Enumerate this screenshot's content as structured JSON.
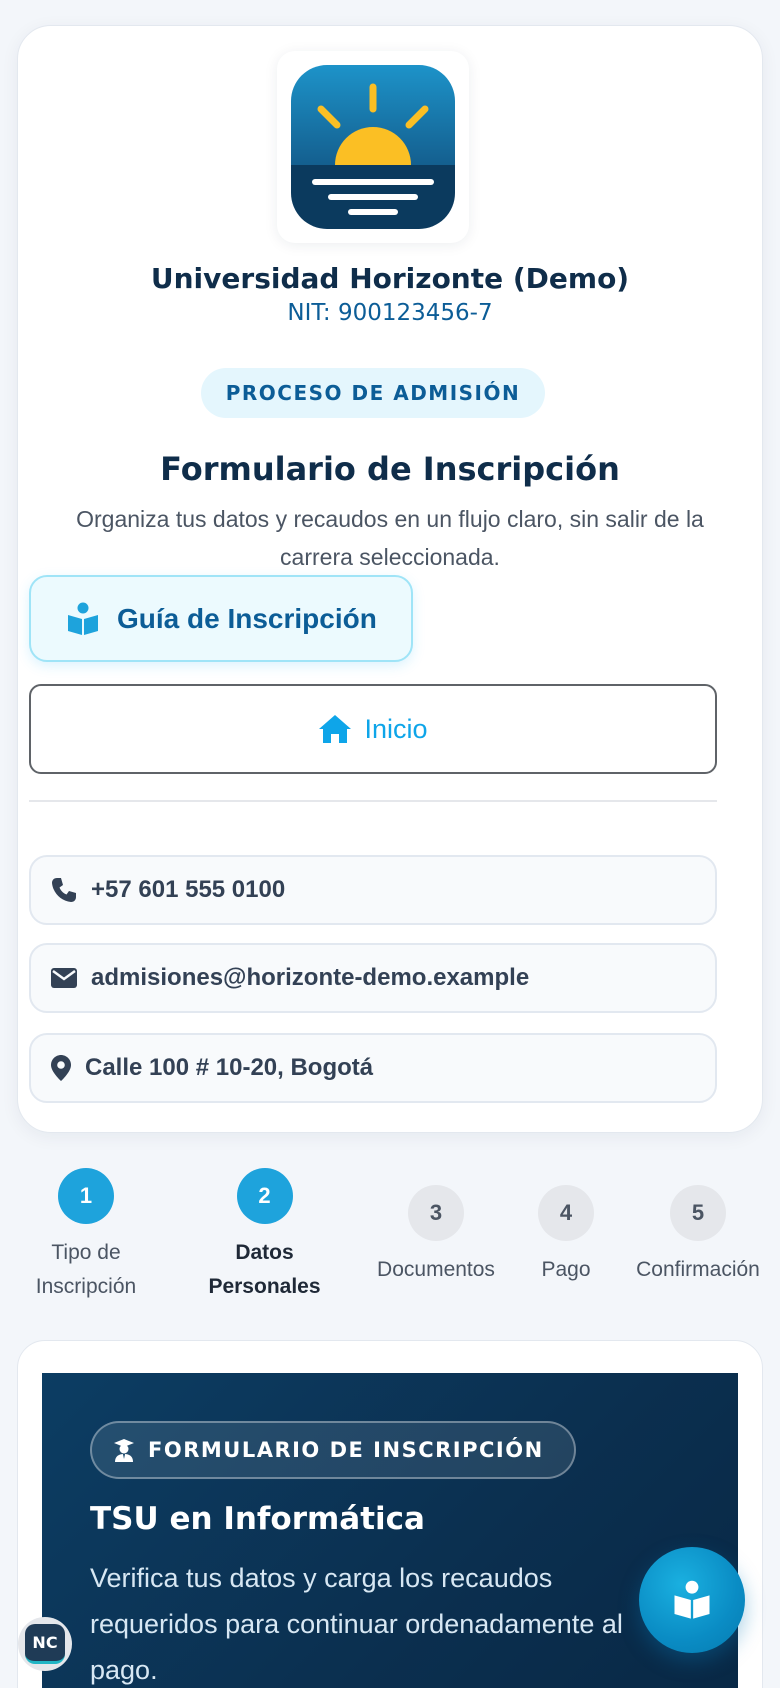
{
  "header": {
    "logo_icon": "sunrise-logo-icon",
    "university_name": "Universidad Horizonte (Demo)",
    "nit": "NIT: 900123456-7",
    "process_badge": "PROCESO DE ADMISIÓN",
    "form_title": "Formulario de Inscripción",
    "form_description": "Organiza tus datos y recaudos en un flujo claro, sin salir de la carrera seleccionada."
  },
  "actions": {
    "guide_label": "Guía de Inscripción",
    "guide_icon": "book-reader-icon",
    "home_label": "Inicio",
    "home_icon": "home-icon"
  },
  "contacts": [
    {
      "icon": "phone-icon",
      "text": "+57 601 555 0100"
    },
    {
      "icon": "envelope-icon",
      "text": "admisiones@horizonte-demo.example"
    },
    {
      "icon": "map-pin-icon",
      "text": "Calle 100 # 10-20, Bogotá"
    }
  ],
  "stepper": {
    "current_step": 2,
    "steps": [
      {
        "number": "1",
        "label": "Tipo de Inscripción",
        "state": "done"
      },
      {
        "number": "2",
        "label": "Datos Personales",
        "state": "current"
      },
      {
        "number": "3",
        "label": "Documentos",
        "state": "pending"
      },
      {
        "number": "4",
        "label": "Pago",
        "state": "pending"
      },
      {
        "number": "5",
        "label": "Confirmación",
        "state": "pending"
      }
    ]
  },
  "hero": {
    "badge_icon": "graduate-icon",
    "badge_label": "FORMULARIO DE INSCRIPCIÓN",
    "program_title": "TSU en Informática",
    "description": "Verifica tus datos y carga los recaudos requeridos para continuar ordenadamente al pago."
  },
  "fab": {
    "icon": "book-reader-icon"
  },
  "corner_badge": {
    "text": "NC"
  },
  "colors": {
    "primary": "#0c5d97",
    "accent": "#1ea3dc",
    "dark_navy": "#0f2d4a",
    "sun": "#fbbf24"
  }
}
